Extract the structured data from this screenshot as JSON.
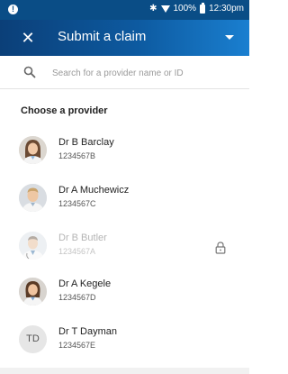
{
  "status_bar": {
    "battery_text": "100%",
    "time": "12:30pm",
    "icons": [
      "notification-icon",
      "bluetooth-icon",
      "wifi-icon",
      "battery-icon"
    ]
  },
  "app_bar": {
    "title": "Submit a claim",
    "close_icon": "close-icon",
    "menu_icon": "chevron-down-icon"
  },
  "search": {
    "placeholder": "Search for a provider name or ID",
    "value": ""
  },
  "list": {
    "section_title": "Choose a provider",
    "providers": [
      {
        "name": "Dr B Barclay",
        "id": "1234567B",
        "avatar": "female-doctor-photo",
        "locked": false
      },
      {
        "name": "Dr A Muchewicz",
        "id": "1234567C",
        "avatar": "male-doctor-photo",
        "locked": false
      },
      {
        "name": "Dr B Butler",
        "id": "1234567A",
        "avatar": "male-doctor-photo",
        "locked": true
      },
      {
        "name": "Dr A Kegele",
        "id": "1234567D",
        "avatar": "female-doctor-photo",
        "locked": false
      },
      {
        "name": "Dr T Dayman",
        "id": "1234567E",
        "avatar_initials": "TD",
        "locked": false
      }
    ]
  },
  "colors": {
    "status_bar": "#0a4d86",
    "app_bar_start": "#0b3f78",
    "app_bar_end": "#1a7fd0",
    "disabled_text": "#b5b5b5"
  }
}
